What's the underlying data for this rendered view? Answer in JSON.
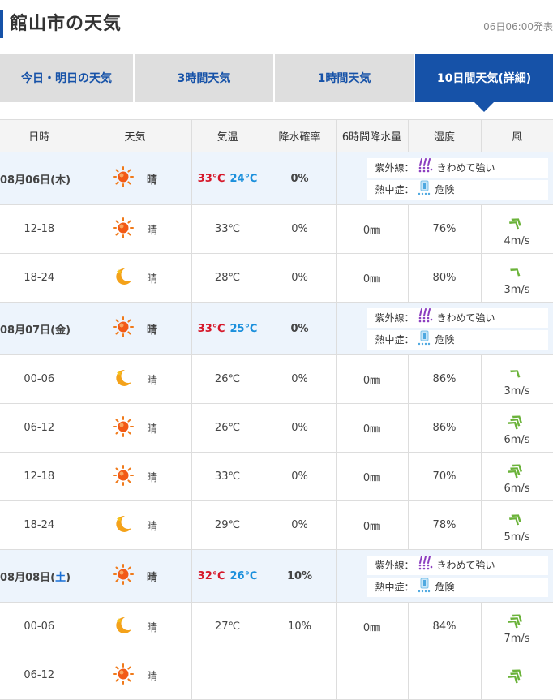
{
  "header": {
    "title": "館山市の天気",
    "stamp": "06日06:00発表"
  },
  "tabs": [
    {
      "label": "今日・明日の天気",
      "active": false
    },
    {
      "label": "3時間天気",
      "active": false
    },
    {
      "label": "1時間天気",
      "active": false
    },
    {
      "label": "10日間天気(詳細)",
      "active": true
    }
  ],
  "columns": [
    "日時",
    "天気",
    "気温",
    "降水確率",
    "6時間降水量",
    "湿度",
    "風"
  ],
  "labels": {
    "uv": "紫外線：",
    "heat": "熱中症："
  },
  "colors": {
    "accent": "#1652a8",
    "high": "#d6182a",
    "low": "#1a8fdc",
    "uv": "#8c3fc0",
    "wind": "#6bb33a"
  },
  "days": [
    {
      "date_prefix": "08月06日(",
      "dow": "木",
      "date_suffix": ")",
      "weather": "晴",
      "icon": "sun-icon",
      "high": "33℃",
      "low": "24℃",
      "precip": "0%",
      "uv": "きわめて強い",
      "heat": "危険",
      "hours": [
        {
          "time": "12-18",
          "icon": "sun-icon",
          "weather": "晴",
          "temp": "33℃",
          "precip": "0%",
          "rain": "0㎜",
          "humidity": "76%",
          "wind": "4m/s",
          "wind_level": 1
        },
        {
          "time": "18-24",
          "icon": "moon-icon",
          "weather": "晴",
          "temp": "28℃",
          "precip": "0%",
          "rain": "0㎜",
          "humidity": "80%",
          "wind": "3m/s",
          "wind_level": 0
        }
      ]
    },
    {
      "date_prefix": "08月07日(",
      "dow": "金",
      "date_suffix": ")",
      "weather": "晴",
      "icon": "sun-icon",
      "high": "33℃",
      "low": "25℃",
      "precip": "0%",
      "uv": "きわめて強い",
      "heat": "危険",
      "hours": [
        {
          "time": "00-06",
          "icon": "moon-icon",
          "weather": "晴",
          "temp": "26℃",
          "precip": "0%",
          "rain": "0㎜",
          "humidity": "86%",
          "wind": "3m/s",
          "wind_level": 0
        },
        {
          "time": "06-12",
          "icon": "sun-icon",
          "weather": "晴",
          "temp": "26℃",
          "precip": "0%",
          "rain": "0㎜",
          "humidity": "86%",
          "wind": "6m/s",
          "wind_level": 2
        },
        {
          "time": "12-18",
          "icon": "sun-icon",
          "weather": "晴",
          "temp": "33℃",
          "precip": "0%",
          "rain": "0㎜",
          "humidity": "70%",
          "wind": "6m/s",
          "wind_level": 2
        },
        {
          "time": "18-24",
          "icon": "moon-icon",
          "weather": "晴",
          "temp": "29℃",
          "precip": "0%",
          "rain": "0㎜",
          "humidity": "78%",
          "wind": "5m/s",
          "wind_level": 1
        }
      ]
    },
    {
      "date_prefix": "08月08日(",
      "dow": "土",
      "date_suffix": ")",
      "saturday": true,
      "weather": "晴",
      "icon": "sun-icon",
      "high": "32℃",
      "low": "26℃",
      "precip": "10%",
      "uv": "きわめて強い",
      "heat": "危険",
      "hours": [
        {
          "time": "00-06",
          "icon": "moon-icon",
          "weather": "晴",
          "temp": "27℃",
          "precip": "10%",
          "rain": "0㎜",
          "humidity": "84%",
          "wind": "7m/s",
          "wind_level": 2
        },
        {
          "time": "06-12",
          "icon": "sun-icon",
          "weather": "晴",
          "temp": "",
          "precip": "",
          "rain": "",
          "humidity": "",
          "wind": "",
          "wind_level": 2
        }
      ]
    }
  ]
}
